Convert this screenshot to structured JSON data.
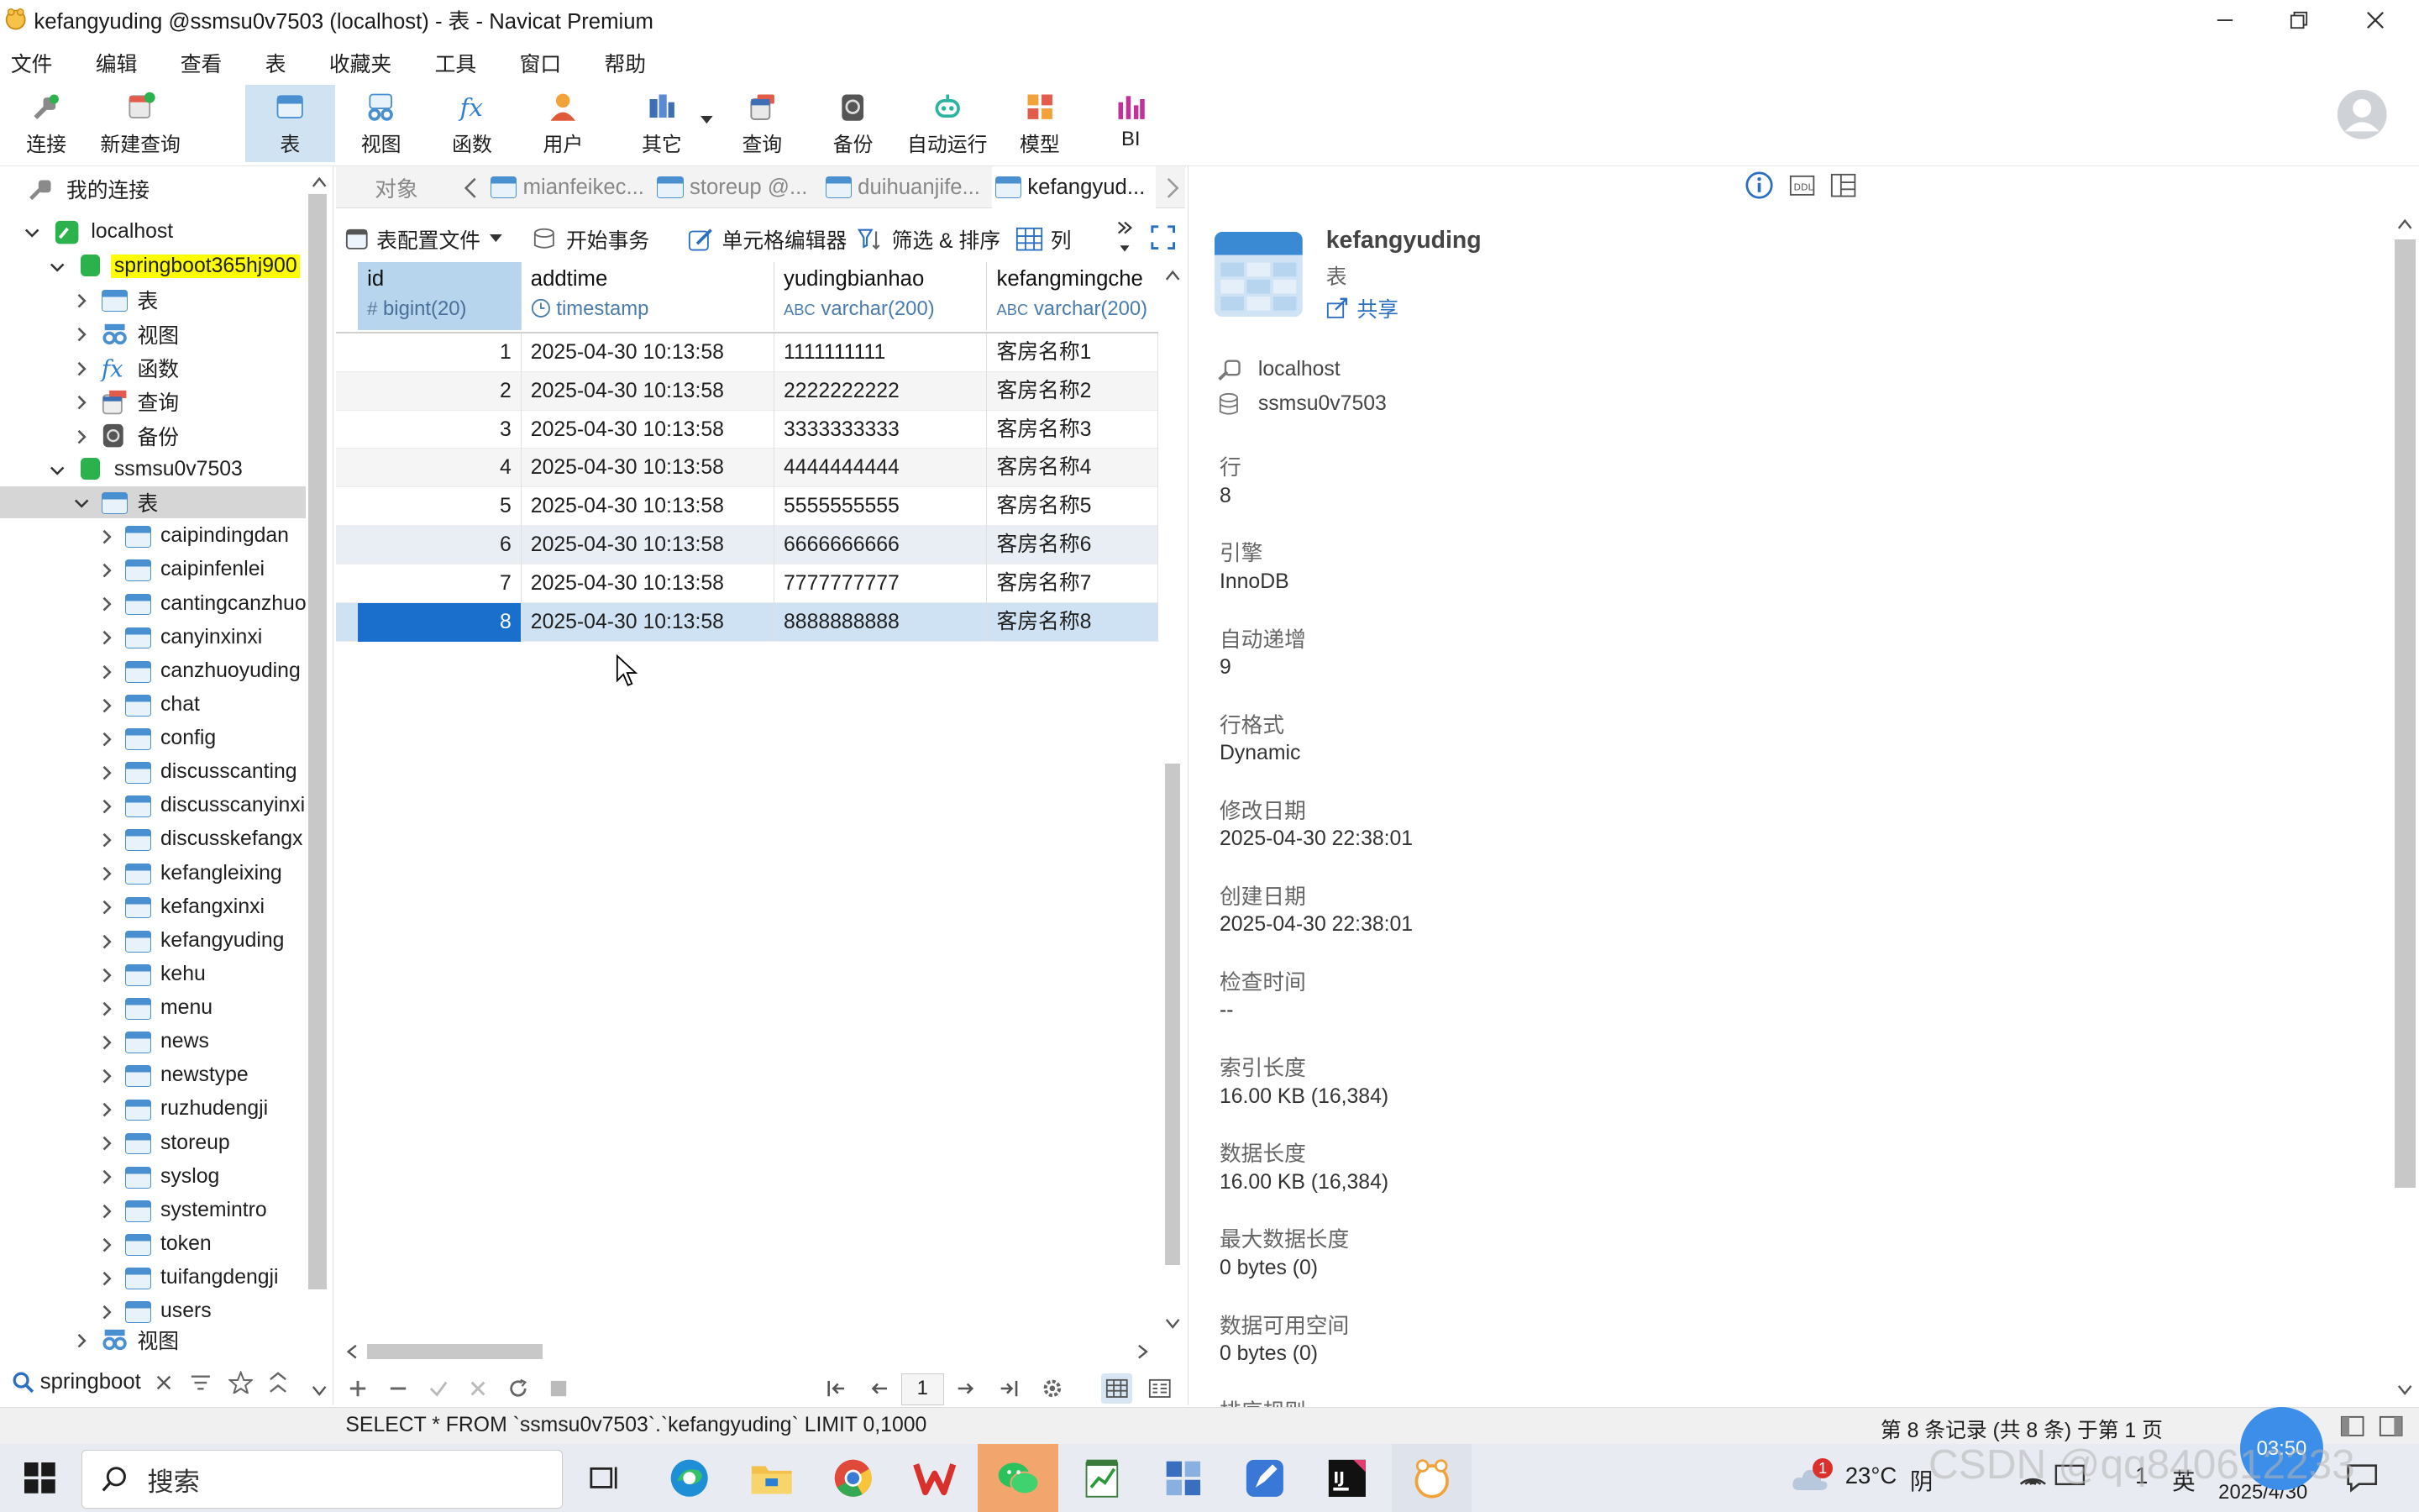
{
  "window": {
    "title": "kefangyuding @ssmsu0v7503 (localhost) - 表 - Navicat Premium"
  },
  "menu": [
    "文件",
    "编辑",
    "查看",
    "表",
    "收藏夹",
    "工具",
    "窗口",
    "帮助"
  ],
  "toolbar": {
    "connect": "连接",
    "new_query": "新建查询",
    "table": "表",
    "view": "视图",
    "function": "函数",
    "user": "用户",
    "other": "其它",
    "query": "查询",
    "backup": "备份",
    "auto_run": "自动运行",
    "model": "模型",
    "bi": "BI"
  },
  "tree": {
    "root": "我的连接",
    "connection": "localhost",
    "db1": "springboot365hj900",
    "db1_children": [
      "表",
      "视图",
      "函数",
      "查询",
      "备份"
    ],
    "db2": "ssmsu0v7503",
    "tables_node": "表",
    "tables": [
      "caipindingdan",
      "caipinfenlei",
      "cantingcanzhuo",
      "canyinxinxi",
      "canzhuoyuding",
      "chat",
      "config",
      "discusscanting",
      "discusscanyinxi",
      "discusskefangx",
      "kefangleixing",
      "kefangxinxi",
      "kefangyuding",
      "kehu",
      "menu",
      "news",
      "newstype",
      "ruzhudengji",
      "storeup",
      "syslog",
      "systemintro",
      "token",
      "tuifangdengji",
      "users"
    ],
    "views_node": "视图",
    "search_value": "springboot"
  },
  "tabs": {
    "objects": "对象",
    "items": [
      "mianfeikec...",
      "storeup @...",
      "duihuanjife...",
      "kefangyud..."
    ]
  },
  "data_toolbar": {
    "table_profile": "表配置文件",
    "begin_transaction": "开始事务",
    "cell_editor": "单元格编辑器",
    "filter_sort": "筛选 & 排序",
    "columns": "列"
  },
  "grid": {
    "columns": [
      {
        "name": "id",
        "type": "bigint(20)"
      },
      {
        "name": "addtime",
        "type": "timestamp"
      },
      {
        "name": "yudingbianhao",
        "type": "varchar(200)"
      },
      {
        "name": "kefangmingche",
        "type": "varchar(200)"
      }
    ],
    "rows": [
      [
        "1",
        "2025-04-30 10:13:58",
        "1111111111",
        "客房名称1"
      ],
      [
        "2",
        "2025-04-30 10:13:58",
        "2222222222",
        "客房名称2"
      ],
      [
        "3",
        "2025-04-30 10:13:58",
        "3333333333",
        "客房名称3"
      ],
      [
        "4",
        "2025-04-30 10:13:58",
        "4444444444",
        "客房名称4"
      ],
      [
        "5",
        "2025-04-30 10:13:58",
        "5555555555",
        "客房名称5"
      ],
      [
        "6",
        "2025-04-30 10:13:58",
        "6666666666",
        "客房名称6"
      ],
      [
        "7",
        "2025-04-30 10:13:58",
        "7777777777",
        "客房名称7"
      ],
      [
        "8",
        "2025-04-30 10:13:58",
        "8888888888",
        "客房名称8"
      ]
    ],
    "page": "1"
  },
  "info": {
    "name": "kefangyuding",
    "kind": "表",
    "share": "共享",
    "host": "localhost",
    "database": "ssmsu0v7503",
    "fields": [
      {
        "label": "行",
        "value": "8"
      },
      {
        "label": "引擎",
        "value": "InnoDB"
      },
      {
        "label": "自动递增",
        "value": "9"
      },
      {
        "label": "行格式",
        "value": "Dynamic"
      },
      {
        "label": "修改日期",
        "value": "2025-04-30 22:38:01"
      },
      {
        "label": "创建日期",
        "value": "2025-04-30 22:38:01"
      },
      {
        "label": "检查时间",
        "value": "--"
      },
      {
        "label": "索引长度",
        "value": "16.00 KB (16,384)"
      },
      {
        "label": "数据长度",
        "value": "16.00 KB (16,384)"
      },
      {
        "label": "最大数据长度",
        "value": "0 bytes (0)"
      },
      {
        "label": "数据可用空间",
        "value": "0 bytes (0)"
      },
      {
        "label": "排序规则",
        "value": ""
      }
    ]
  },
  "status": {
    "sql": "SELECT * FROM `ssmsu0v7503`.`kefangyuding` LIMIT 0,1000",
    "record_info": "第 8 条记录 (共 8 条) 于第 1 页"
  },
  "taskbar": {
    "search_placeholder": "搜索",
    "weather": "23°C",
    "weather_desc": "阴",
    "lang": "英",
    "date": "2025/4/30",
    "clock_badge": "03:50",
    "weather_badge": "1",
    "tray_num": "1",
    "watermark": "CSDN @qq840612233"
  },
  "colors": {
    "accent": "#0a64c8",
    "selected_row": "#cfe2f3",
    "highlight_db": "#ffff00",
    "active_tab_bg": "#cfe3f3"
  }
}
